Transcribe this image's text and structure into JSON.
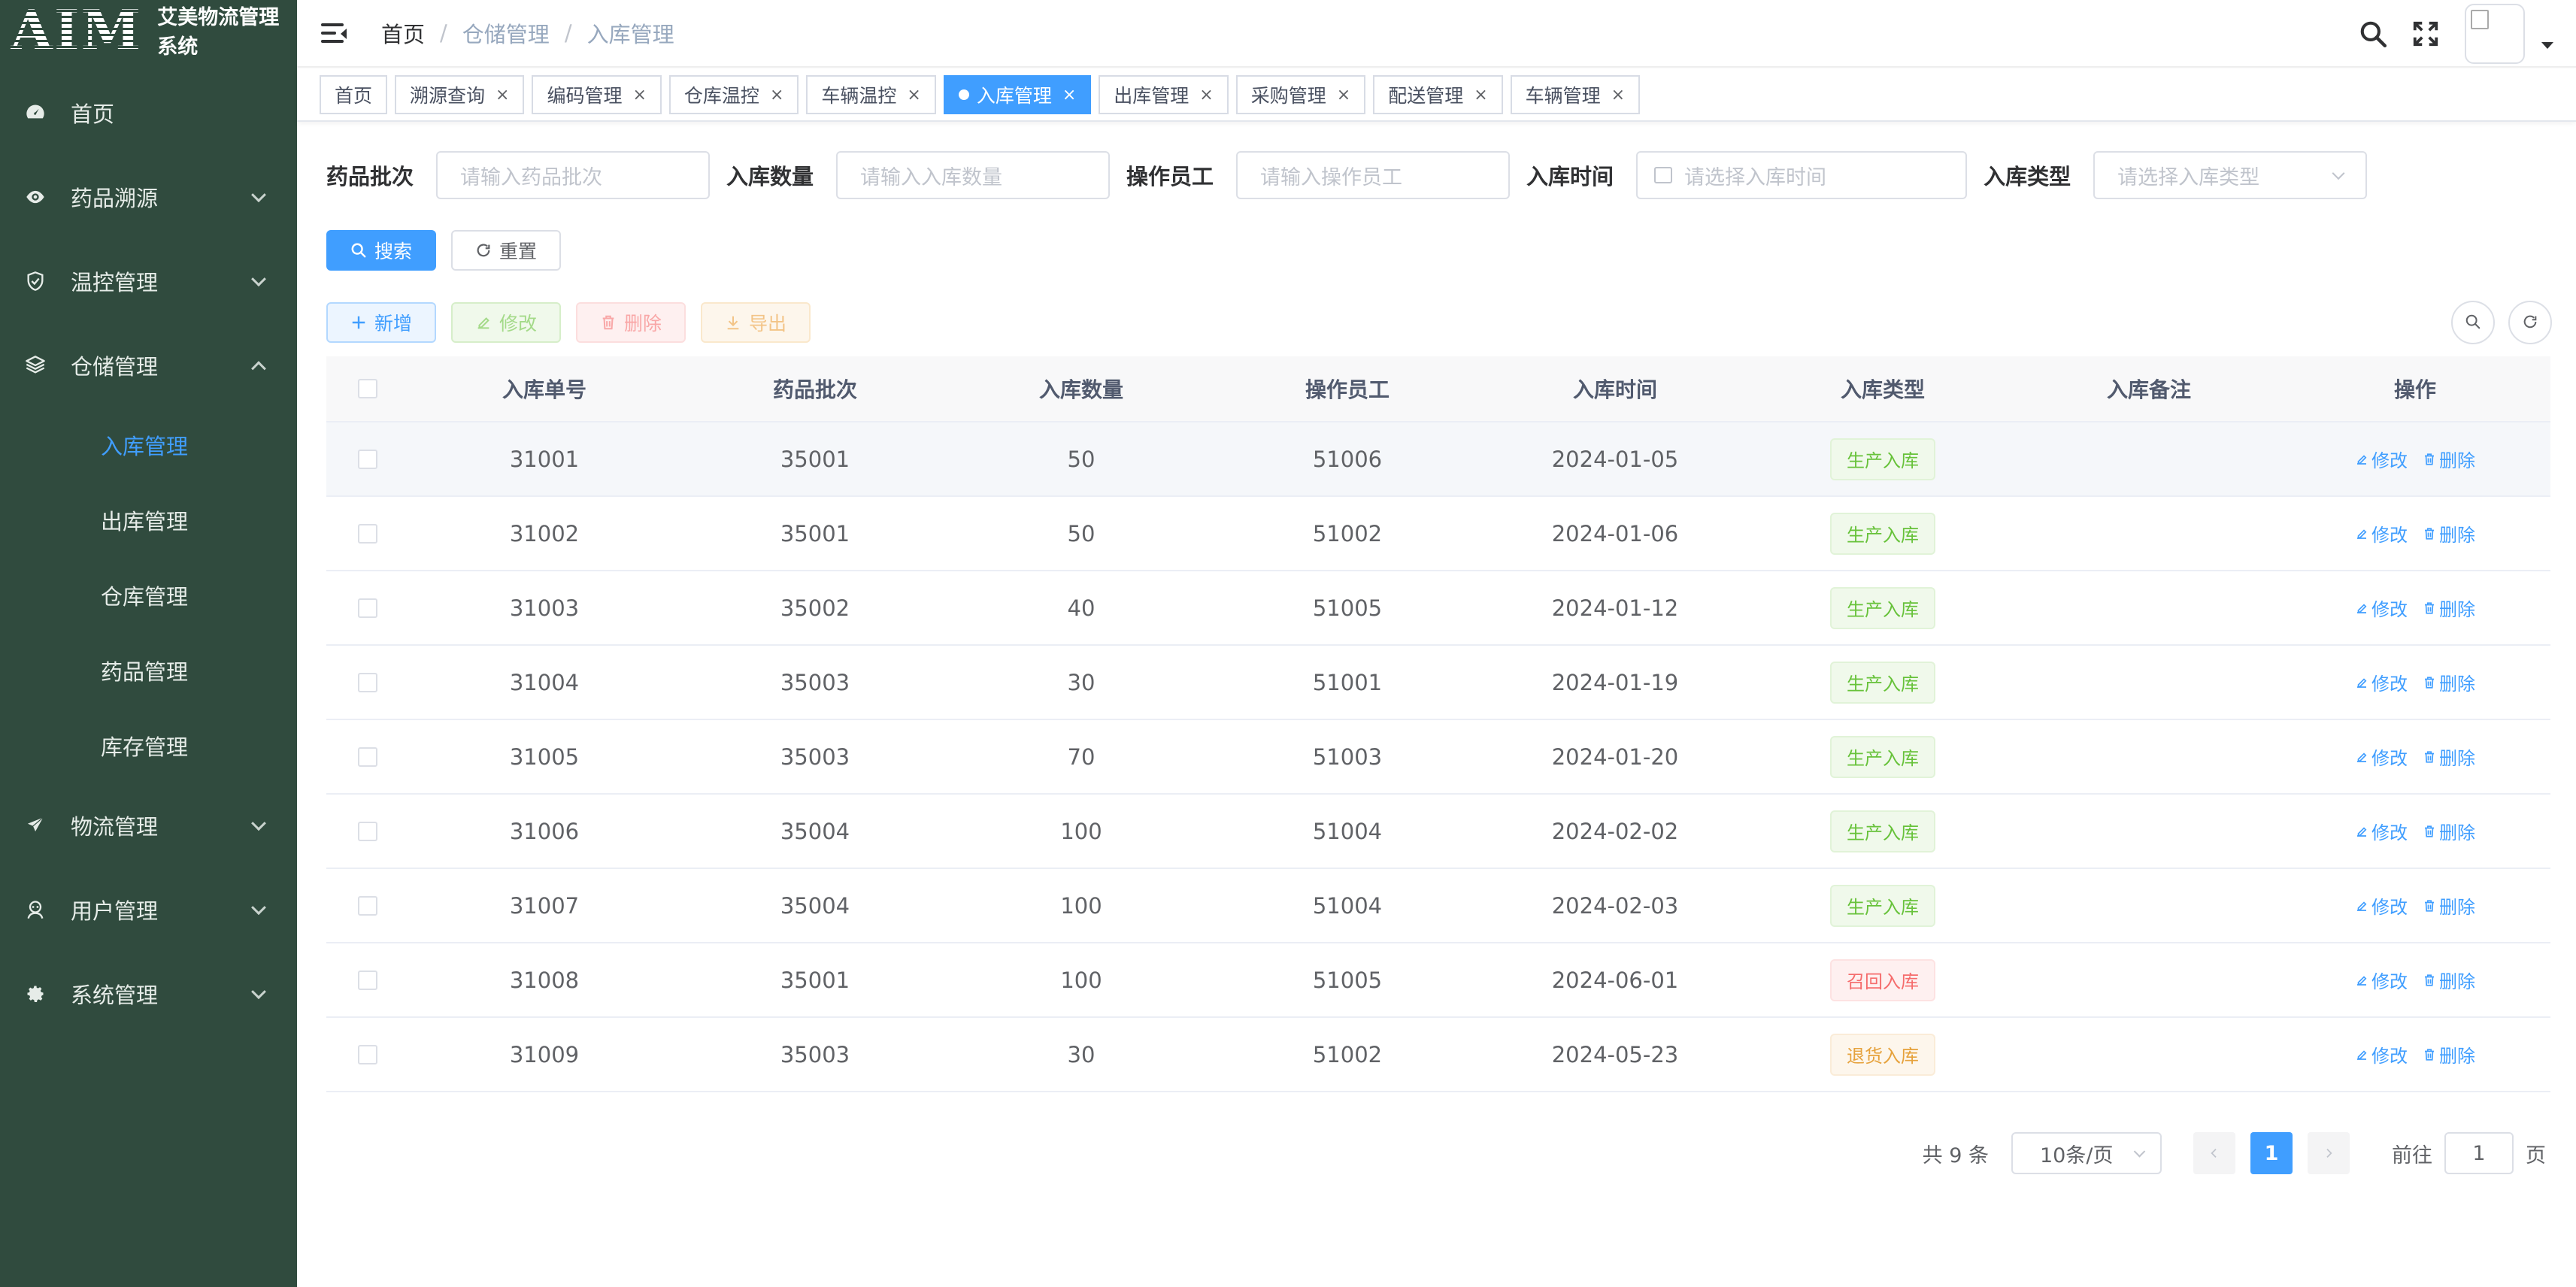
{
  "app": {
    "logo_text": "AIM",
    "title": "艾美物流管理系统"
  },
  "sidebar": {
    "items": [
      {
        "label": "首页",
        "icon": "dashboard-icon"
      },
      {
        "label": "药品溯源",
        "icon": "eye-icon"
      },
      {
        "label": "温控管理",
        "icon": "shield-check-icon"
      },
      {
        "label": "仓储管理",
        "icon": "layers-icon"
      },
      {
        "label": "物流管理",
        "icon": "send-icon"
      },
      {
        "label": "用户管理",
        "icon": "user-group-icon"
      },
      {
        "label": "系统管理",
        "icon": "gear-icon"
      }
    ],
    "warehouse_sub": [
      "入库管理",
      "出库管理",
      "仓库管理",
      "药品管理",
      "库存管理"
    ],
    "active_sub": "入库管理"
  },
  "header": {
    "breadcrumb": [
      "首页",
      "仓储管理",
      "入库管理"
    ]
  },
  "tags": [
    "首页",
    "溯源查询",
    "编码管理",
    "仓库温控",
    "车辆温控",
    "入库管理",
    "出库管理",
    "采购管理",
    "配送管理",
    "车辆管理"
  ],
  "form": {
    "batch_label": "药品批次",
    "batch_placeholder": "请输入药品批次",
    "qty_label": "入库数量",
    "qty_placeholder": "请输入入库数量",
    "staff_label": "操作员工",
    "staff_placeholder": "请输入操作员工",
    "time_label": "入库时间",
    "time_placeholder": "请选择入库时间",
    "type_label": "入库类型",
    "type_placeholder": "请选择入库类型",
    "search_btn": "搜索",
    "reset_btn": "重置"
  },
  "toolbar": {
    "add": "新增",
    "edit": "修改",
    "delete": "删除",
    "export": "导出"
  },
  "table": {
    "columns": [
      "入库单号",
      "药品批次",
      "入库数量",
      "操作员工",
      "入库时间",
      "入库类型",
      "入库备注",
      "操作"
    ],
    "edit_label": "修改",
    "delete_label": "删除",
    "rows": [
      {
        "id": "31001",
        "batch": "35001",
        "qty": "50",
        "staff": "51006",
        "time": "2024-01-05",
        "type": "生产入库",
        "type_color": "green",
        "note": ""
      },
      {
        "id": "31002",
        "batch": "35001",
        "qty": "50",
        "staff": "51002",
        "time": "2024-01-06",
        "type": "生产入库",
        "type_color": "green",
        "note": ""
      },
      {
        "id": "31003",
        "batch": "35002",
        "qty": "40",
        "staff": "51005",
        "time": "2024-01-12",
        "type": "生产入库",
        "type_color": "green",
        "note": ""
      },
      {
        "id": "31004",
        "batch": "35003",
        "qty": "30",
        "staff": "51001",
        "time": "2024-01-19",
        "type": "生产入库",
        "type_color": "green",
        "note": ""
      },
      {
        "id": "31005",
        "batch": "35003",
        "qty": "70",
        "staff": "51003",
        "time": "2024-01-20",
        "type": "生产入库",
        "type_color": "green",
        "note": ""
      },
      {
        "id": "31006",
        "batch": "35004",
        "qty": "100",
        "staff": "51004",
        "time": "2024-02-02",
        "type": "生产入库",
        "type_color": "green",
        "note": ""
      },
      {
        "id": "31007",
        "batch": "35004",
        "qty": "100",
        "staff": "51004",
        "time": "2024-02-03",
        "type": "生产入库",
        "type_color": "green",
        "note": ""
      },
      {
        "id": "31008",
        "batch": "35001",
        "qty": "100",
        "staff": "51005",
        "time": "2024-06-01",
        "type": "召回入库",
        "type_color": "red",
        "note": ""
      },
      {
        "id": "31009",
        "batch": "35003",
        "qty": "30",
        "staff": "51002",
        "time": "2024-05-23",
        "type": "退货入库",
        "type_color": "orange",
        "note": ""
      }
    ]
  },
  "pagination": {
    "total_text": "共 9 条",
    "page_size": "10条/页",
    "current_page": "1",
    "goto_label": "前往",
    "goto_value": "1",
    "page_suffix": "页"
  },
  "colors": {
    "sidebar_bg": "#304b3e",
    "primary": "#409eff",
    "success": "#67c23a",
    "danger": "#f56c6c",
    "warning": "#e6a23c"
  }
}
